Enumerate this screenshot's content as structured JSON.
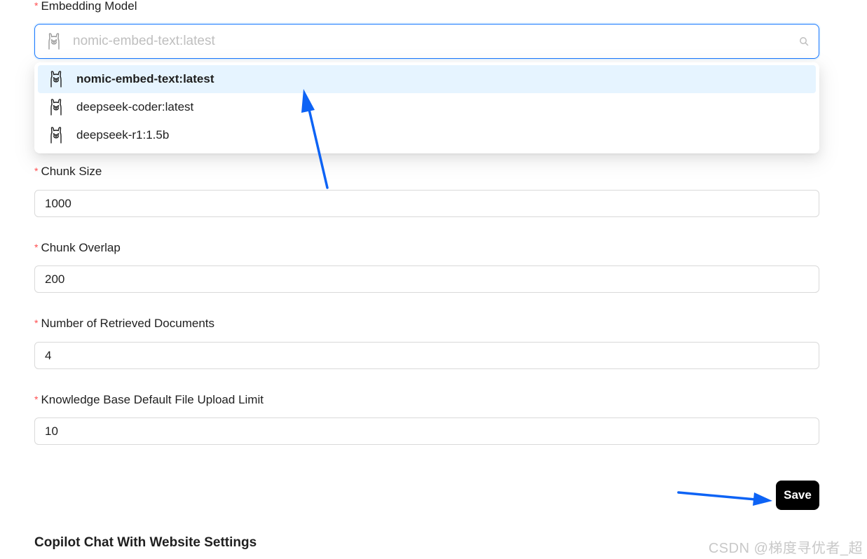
{
  "form": {
    "embedding_model": {
      "label": "Embedding Model",
      "required_mark": "*",
      "placeholder": "nomic-embed-text:latest",
      "options": [
        {
          "label": "nomic-embed-text:latest",
          "icon": "llama-icon",
          "selected": true
        },
        {
          "label": "deepseek-coder:latest",
          "icon": "llama-icon",
          "selected": false
        },
        {
          "label": "deepseek-r1:1.5b",
          "icon": "llama-icon",
          "selected": false
        }
      ]
    },
    "chunk_size": {
      "label": "Chunk Size",
      "required_mark": "*",
      "value": "1000"
    },
    "chunk_overlap": {
      "label": "Chunk Overlap",
      "required_mark": "*",
      "value": "200"
    },
    "retrieved_docs": {
      "label": "Number of Retrieved Documents",
      "required_mark": "*",
      "value": "4"
    },
    "upload_limit": {
      "label": "Knowledge Base Default File Upload Limit",
      "required_mark": "*",
      "value": "10"
    },
    "save_label": "Save"
  },
  "next_section": {
    "title": "Copilot Chat With Website Settings"
  },
  "watermark": "CSDN @梯度寻优者_超",
  "colors": {
    "accent": "#1677ff",
    "required": "#ff4d4f",
    "selected_option_bg": "#e6f4ff",
    "annotation_arrow": "#0d63f5",
    "save_button_bg": "#000000"
  }
}
